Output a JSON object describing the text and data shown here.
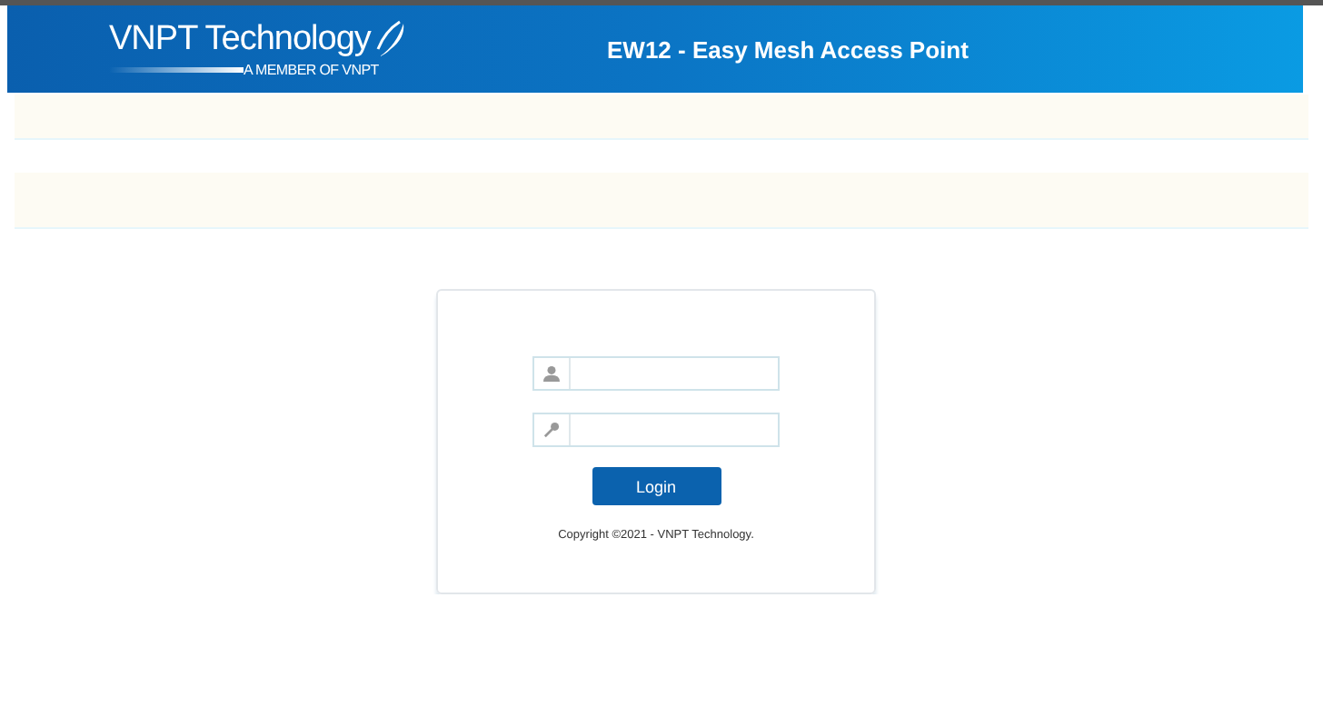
{
  "header": {
    "brand": "VNPT Technology",
    "tagline": "A MEMBER OF VNPT",
    "title": "EW12 - Easy Mesh Access Point"
  },
  "login": {
    "fields": [
      {
        "kind": "user"
      },
      {
        "kind": "password"
      }
    ],
    "button": "Login",
    "copyright": "Copyright ©2021 - VNPT Technology."
  }
}
